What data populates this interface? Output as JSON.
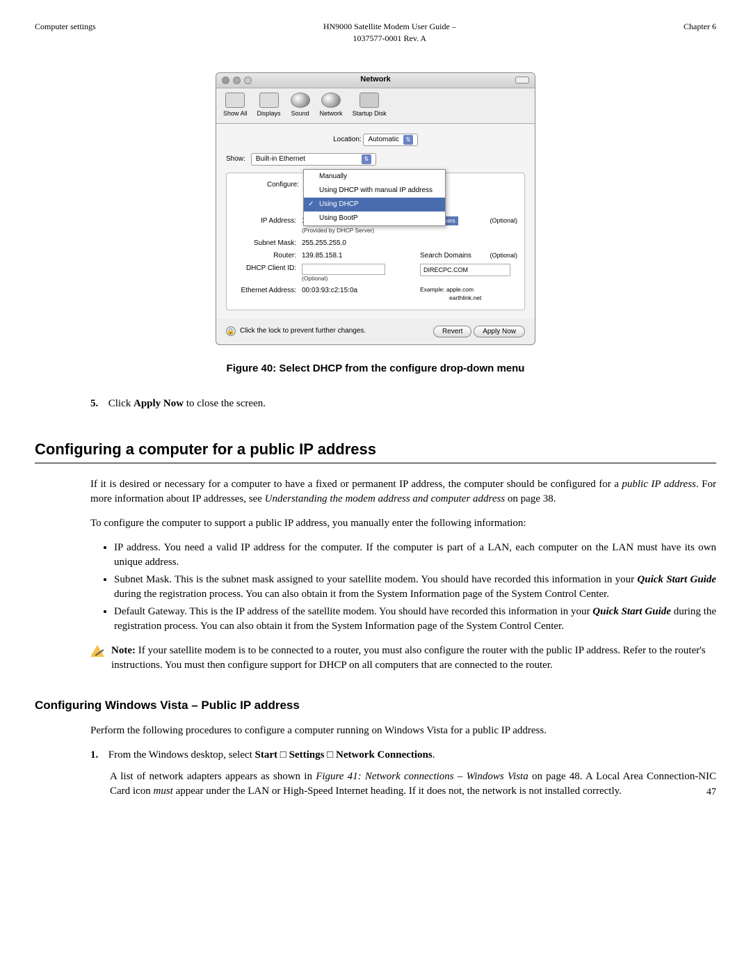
{
  "header": {
    "left": "Computer settings",
    "center_line1": "HN9000 Satellite Modem User Guide –",
    "center_line2": "1037577-0001 Rev. A",
    "right": "Chapter 6"
  },
  "window": {
    "title": "Network",
    "toolbar": {
      "showall": "Show All",
      "displays": "Displays",
      "sound": "Sound",
      "network": "Network",
      "startup": "Startup Disk"
    },
    "location_label": "Location:",
    "location_value": "Automatic",
    "show_label": "Show:",
    "show_value": "Built-in Ethernet",
    "configure_label": "Configure:",
    "menu": {
      "manually": "Manually",
      "dhcp_manual": "Using DHCP with manual IP address",
      "dhcp": "Using DHCP",
      "bootp": "Using BootP"
    },
    "ip_label": "IP Address:",
    "ip_value": "139.85.158.186",
    "ip_sub": "(Provided by DHCP Server)",
    "subnet_label": "Subnet Mask:",
    "subnet_value": "255.255.255.0",
    "router_label": "Router:",
    "router_value": "139.85.158.1",
    "dhcp_client_label": "DHCP Client ID:",
    "dhcp_client_sub": "(Optional)",
    "eth_label": "Ethernet Address:",
    "eth_value": "00:03:93:c2:15:0a",
    "dns_servers": "DNS Servers",
    "optional": "(Optional)",
    "search_domains": "Search Domains",
    "search_value": "DIRECPC.COM",
    "example_label": "Example:",
    "example_val1": "apple.com",
    "example_val2": "earthlink.net",
    "lock_text": "Click the lock to prevent further changes.",
    "revert": "Revert",
    "apply_now": "Apply Now"
  },
  "figure_caption": "Figure 40: Select DHCP from the configure drop-down menu",
  "step5": {
    "num": "5.",
    "pre": "Click ",
    "bold": "Apply Now",
    "post": " to close the screen."
  },
  "h2": "Configuring a computer for a public IP address",
  "para1": {
    "t1": "If it is desired or necessary for a computer to have a fixed or permanent IP address, the computer should be configured for a ",
    "e1": "public IP address",
    "t2": ". For more information about IP addresses, see  ",
    "e2": "Understanding the modem address and computer address",
    "t3": "  on page 38."
  },
  "para2": "To configure the computer to support a public IP address, you manually enter the following information:",
  "bullets": {
    "b1": "IP address. You need a valid IP address for the computer. If the computer is part of a LAN, each computer on the LAN must have its own unique address.",
    "b2_pre": "Subnet Mask. This is the subnet mask assigned to your satellite modem. You should have recorded this information in your ",
    "b2_bold": "Quick Start Guide",
    "b2_post": " during the registration process. You can also obtain it from the System Information page of the System Control Center.",
    "b3_pre": "Default Gateway. This is the IP address of the satellite modem. You should have recorded this information in your ",
    "b3_bold": "Quick Start Guide",
    "b3_post": " during the registration process. You can also obtain it from the System Information page of the System Control Center."
  },
  "note": {
    "label": "Note:",
    "text": "  If your satellite modem is to be connected to a router, you must also configure the router with the public IP address. Refer to the router's instructions. You must then configure support for DHCP on all computers that are connected to the router."
  },
  "h3": "Configuring Windows Vista – Public IP address",
  "para3": "Perform the following procedures to configure a computer running on Windows Vista for a public IP address.",
  "step1": {
    "num": "1.",
    "t1": "From the Windows desktop, select ",
    "b1": "Start",
    "sep": " □ ",
    "b2": "Settings",
    "b3": "Network Connections",
    "dot": ".",
    "sub_t1": "A list of network adapters appears as shown in ",
    "sub_e1": "Figure 41: Network connections – Windows Vista",
    "sub_t2": " on page 48. A Local Area Connection-NIC Card icon ",
    "sub_e2": "must",
    "sub_t3": " appear under the LAN or High-Speed Internet heading. If it does not, the network is not installed correctly."
  },
  "page_num": "47"
}
